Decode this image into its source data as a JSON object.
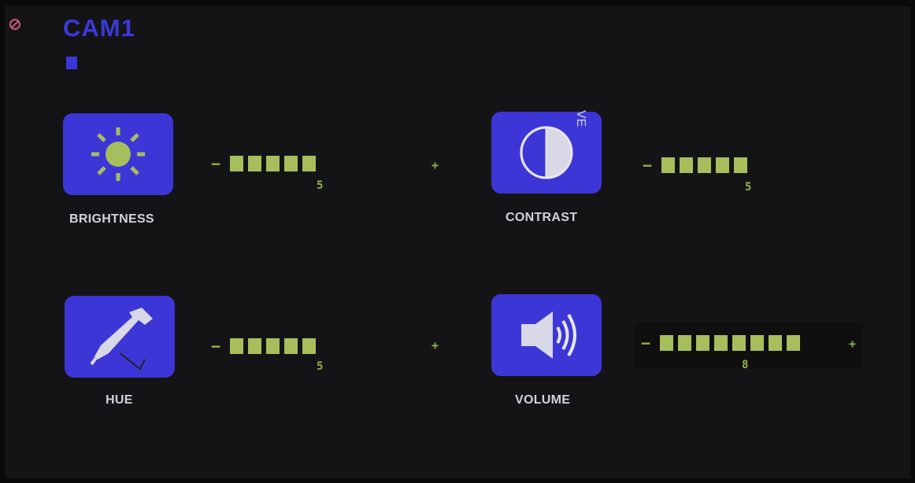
{
  "header": {
    "camera_label": "CAM1"
  },
  "settings": [
    {
      "label": "BRIGHTNESS",
      "icon": "sun-icon",
      "minus": "−",
      "plus": "+",
      "value": "5",
      "segments": 5
    },
    {
      "label": "CONTRAST",
      "icon": "contrast-icon",
      "minus": "−",
      "plus": "",
      "value": "5",
      "segments": 5
    },
    {
      "label": "HUE",
      "icon": "eyedropper-icon",
      "minus": "−",
      "plus": "+",
      "value": "5",
      "segments": 5
    },
    {
      "label": "VOLUME",
      "icon": "speaker-icon",
      "minus": "−",
      "plus": "+",
      "value": "8",
      "segments": 8
    }
  ],
  "overlay_text": "VE",
  "colors": {
    "tile": "#3d36d6",
    "segment": "#a6be5c",
    "label": "#d2d2de",
    "title": "#3b38d9"
  }
}
